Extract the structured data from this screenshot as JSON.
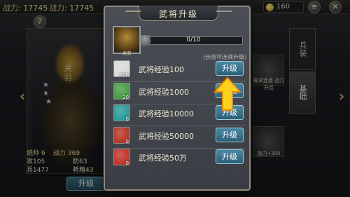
{
  "top": {
    "power_label": "战力:",
    "power_value": "17745",
    "gold_value": "160",
    "help_glyph": "?"
  },
  "hero": {
    "name_vertical": "关羽",
    "stat_row1_left": "统帅 6",
    "stat_row1_right": "战力 369",
    "stat_row2_left": "攻105",
    "stat_row2_right": "防63",
    "stat_row3_left": "兵1477",
    "stat_row3_right": "耗粮43",
    "upgrade_button": "升级"
  },
  "tabs": [
    {
      "label": "兵装",
      "active": false
    },
    {
      "label": "基础",
      "active": true
    }
  ],
  "gear": {
    "slot1_label": "需求连接 战力开启",
    "slot2_label": "战力+390"
  },
  "popup": {
    "title": "武将升级",
    "portrait_caption": "关羽",
    "exp_current": 0,
    "exp_max": 10,
    "exp_text": "0/10",
    "hint": "(长按可连续升级)",
    "items": [
      {
        "name": "武将经验100",
        "count": "106",
        "icon": "scroll-white-icon",
        "color": "#d9d9d9",
        "button": "升级"
      },
      {
        "name": "武将经验1000",
        "count": "20",
        "icon": "book-green-icon",
        "color": "#4d9e4b",
        "button": "升级"
      },
      {
        "name": "武将经验10000",
        "count": "0",
        "icon": "book-teal-icon",
        "color": "#2f9c9b",
        "button": "升级"
      },
      {
        "name": "武将经验50000",
        "count": "0",
        "icon": "bag-red-icon",
        "color": "#b63a2b",
        "button": "升级"
      },
      {
        "name": "武将经验50万",
        "count": "0",
        "icon": "bag-crimson-icon",
        "color": "#c0392b",
        "button": "升级"
      }
    ]
  },
  "colors": {
    "accent_gold": "#b99440",
    "button_blue": "#2b5f78",
    "arrow_yellow": "#ffd21e"
  }
}
